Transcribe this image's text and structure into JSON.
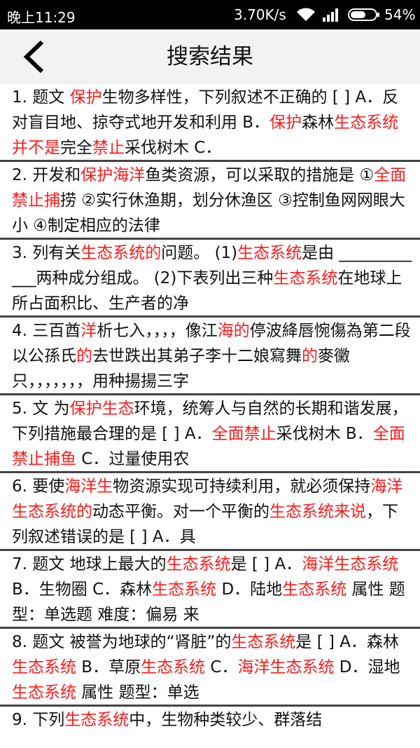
{
  "status_bar": {
    "time": "晚上11:29",
    "network_speed": "3.70K/s",
    "battery": "54%"
  },
  "header": {
    "title": "搜索结果",
    "back_icon": "chevron-left-icon"
  },
  "colors": {
    "highlight": "#ff1a1a",
    "header_bg": "#f2f2f2",
    "status_bg": "#000000"
  },
  "results": [
    {
      "segments": [
        {
          "t": "1. 题文 "
        },
        {
          "t": "保护",
          "h": true
        },
        {
          "t": "生物多样性，下列叙述不正确的 [ ] A．反对盲目地、掠夺式地开发和利用 B．"
        },
        {
          "t": "保护",
          "h": true
        },
        {
          "t": "森林"
        },
        {
          "t": "生态系统并不是",
          "h": true
        },
        {
          "t": "完全"
        },
        {
          "t": "禁止",
          "h": true
        },
        {
          "t": "采伐树木 C．"
        }
      ]
    },
    {
      "segments": [
        {
          "t": "2. 开发和"
        },
        {
          "t": "保护海洋",
          "h": true
        },
        {
          "t": "鱼类资源，可以采取的措施是 ①"
        },
        {
          "t": "全面禁止捕",
          "h": true
        },
        {
          "t": "捞 ②实行休渔期，划分休渔区 ③控制鱼网网眼大小 ④制定相应的法律"
        }
      ]
    },
    {
      "segments": [
        {
          "t": "3. 列有关"
        },
        {
          "t": "生态系统的",
          "h": true
        },
        {
          "t": "问题。 (1)"
        },
        {
          "t": "生态系统",
          "h": true
        },
        {
          "t": "是由 ____________两种成分组成。 (2)下表列出三种"
        },
        {
          "t": "生态系统",
          "h": true
        },
        {
          "t": "在地球上所占面积比、生产者的净"
        }
      ]
    },
    {
      "segments": [
        {
          "t": "4. 三百酋"
        },
        {
          "t": "洋",
          "h": true
        },
        {
          "t": "析七入，，，，像江"
        },
        {
          "t": "海的",
          "h": true
        },
        {
          "t": "停波絳唇惋傷為第二段以公孫氏"
        },
        {
          "t": "的",
          "h": true
        },
        {
          "t": "去世跌出其弟子李十二娘寫舞"
        },
        {
          "t": "的",
          "h": true
        },
        {
          "t": "麥黴只，，，，，，，用种揚揚三字"
        }
      ]
    },
    {
      "segments": [
        {
          "t": "5. 文 为"
        },
        {
          "t": "保护生态",
          "h": true
        },
        {
          "t": "环境，统筹人与自然的长期和谐发展，下列措施最合理的是 [ ] A．"
        },
        {
          "t": "全面禁止",
          "h": true
        },
        {
          "t": "采伐树木 B．"
        },
        {
          "t": "全面禁止捕鱼",
          "h": true
        },
        {
          "t": " C．过量使用农"
        }
      ]
    },
    {
      "segments": [
        {
          "t": "6. 要使"
        },
        {
          "t": "海洋生",
          "h": true
        },
        {
          "t": "物资源实现可持续利用，就必须保持"
        },
        {
          "t": "海洋生态系统的",
          "h": true
        },
        {
          "t": "动态平衡。对一个平衡的"
        },
        {
          "t": "生态系统来说",
          "h": true
        },
        {
          "t": "，下列叙述错误的是 [ ] A．具"
        }
      ]
    },
    {
      "segments": [
        {
          "t": "7. 题文 地球上最大的"
        },
        {
          "t": "生态系统",
          "h": true
        },
        {
          "t": "是 [ ] A．"
        },
        {
          "t": "海洋生态系统",
          "h": true
        },
        {
          "t": " B．生物圈 C．森林"
        },
        {
          "t": "生态系统",
          "h": true
        },
        {
          "t": " D．陆地"
        },
        {
          "t": "生态系统",
          "h": true
        },
        {
          "t": " 属性 题型：单选题 难度：偏易 来"
        }
      ]
    },
    {
      "segments": [
        {
          "t": "8. 题文 被誉为地球的“肾脏”的"
        },
        {
          "t": "生态系统",
          "h": true
        },
        {
          "t": "是 [ ] A．森林"
        },
        {
          "t": "生态系统",
          "h": true
        },
        {
          "t": " B．草原"
        },
        {
          "t": "生态系统",
          "h": true
        },
        {
          "t": " C．"
        },
        {
          "t": "海洋生态系统",
          "h": true
        },
        {
          "t": " D．湿地"
        },
        {
          "t": "生态系统",
          "h": true
        },
        {
          "t": " 属性 题型：单选"
        }
      ]
    },
    {
      "segments": [
        {
          "t": "9. 下列"
        },
        {
          "t": "生态系统",
          "h": true
        },
        {
          "t": "中，生物种类较少、群落结"
        }
      ]
    }
  ]
}
